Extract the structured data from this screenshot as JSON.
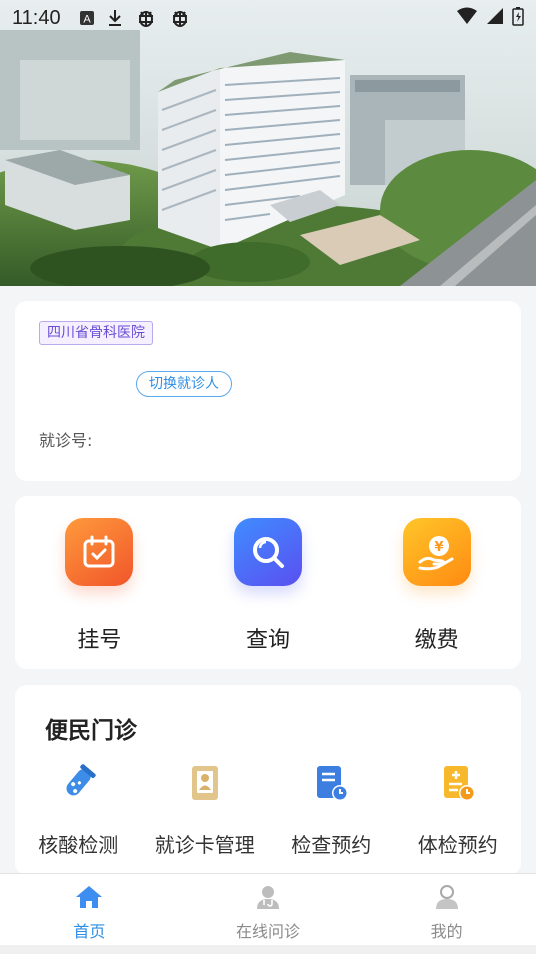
{
  "status_bar": {
    "time": "11:40",
    "left_icons": [
      "notification-a-icon",
      "download-icon",
      "bug-icon",
      "bug-icon"
    ],
    "right_icons": [
      "wifi-icon",
      "signal-icon",
      "battery-icon"
    ]
  },
  "patient_card": {
    "hospital_name": "四川省骨科医院",
    "switch_label": "切换就诊人",
    "visit_no_label": "就诊号:"
  },
  "main_actions": [
    {
      "label": "挂号",
      "icon": "calendar-check-icon",
      "color": "#f4632e"
    },
    {
      "label": "查询",
      "icon": "magnifier-icon",
      "color": "#4d6df6"
    },
    {
      "label": "缴费",
      "icon": "payment-hand-icon",
      "color": "#ffa31c"
    }
  ],
  "services": {
    "title": "便民门诊",
    "items": [
      {
        "label": "核酸检测",
        "icon": "test-tube-icon"
      },
      {
        "label": "就诊卡管理",
        "icon": "id-card-icon"
      },
      {
        "label": "检查预约",
        "icon": "report-clock-icon"
      },
      {
        "label": "体检预约",
        "icon": "checkup-clock-icon"
      }
    ]
  },
  "tabbar": [
    {
      "label": "首页",
      "icon": "home-icon",
      "active": true
    },
    {
      "label": "在线问诊",
      "icon": "doctor-icon",
      "active": false
    },
    {
      "label": "我的",
      "icon": "user-icon",
      "active": false
    }
  ],
  "colors": {
    "accent": "#2f8ee5",
    "background": "#f4f5f7",
    "hospital_tag": "#6a4cd6"
  }
}
